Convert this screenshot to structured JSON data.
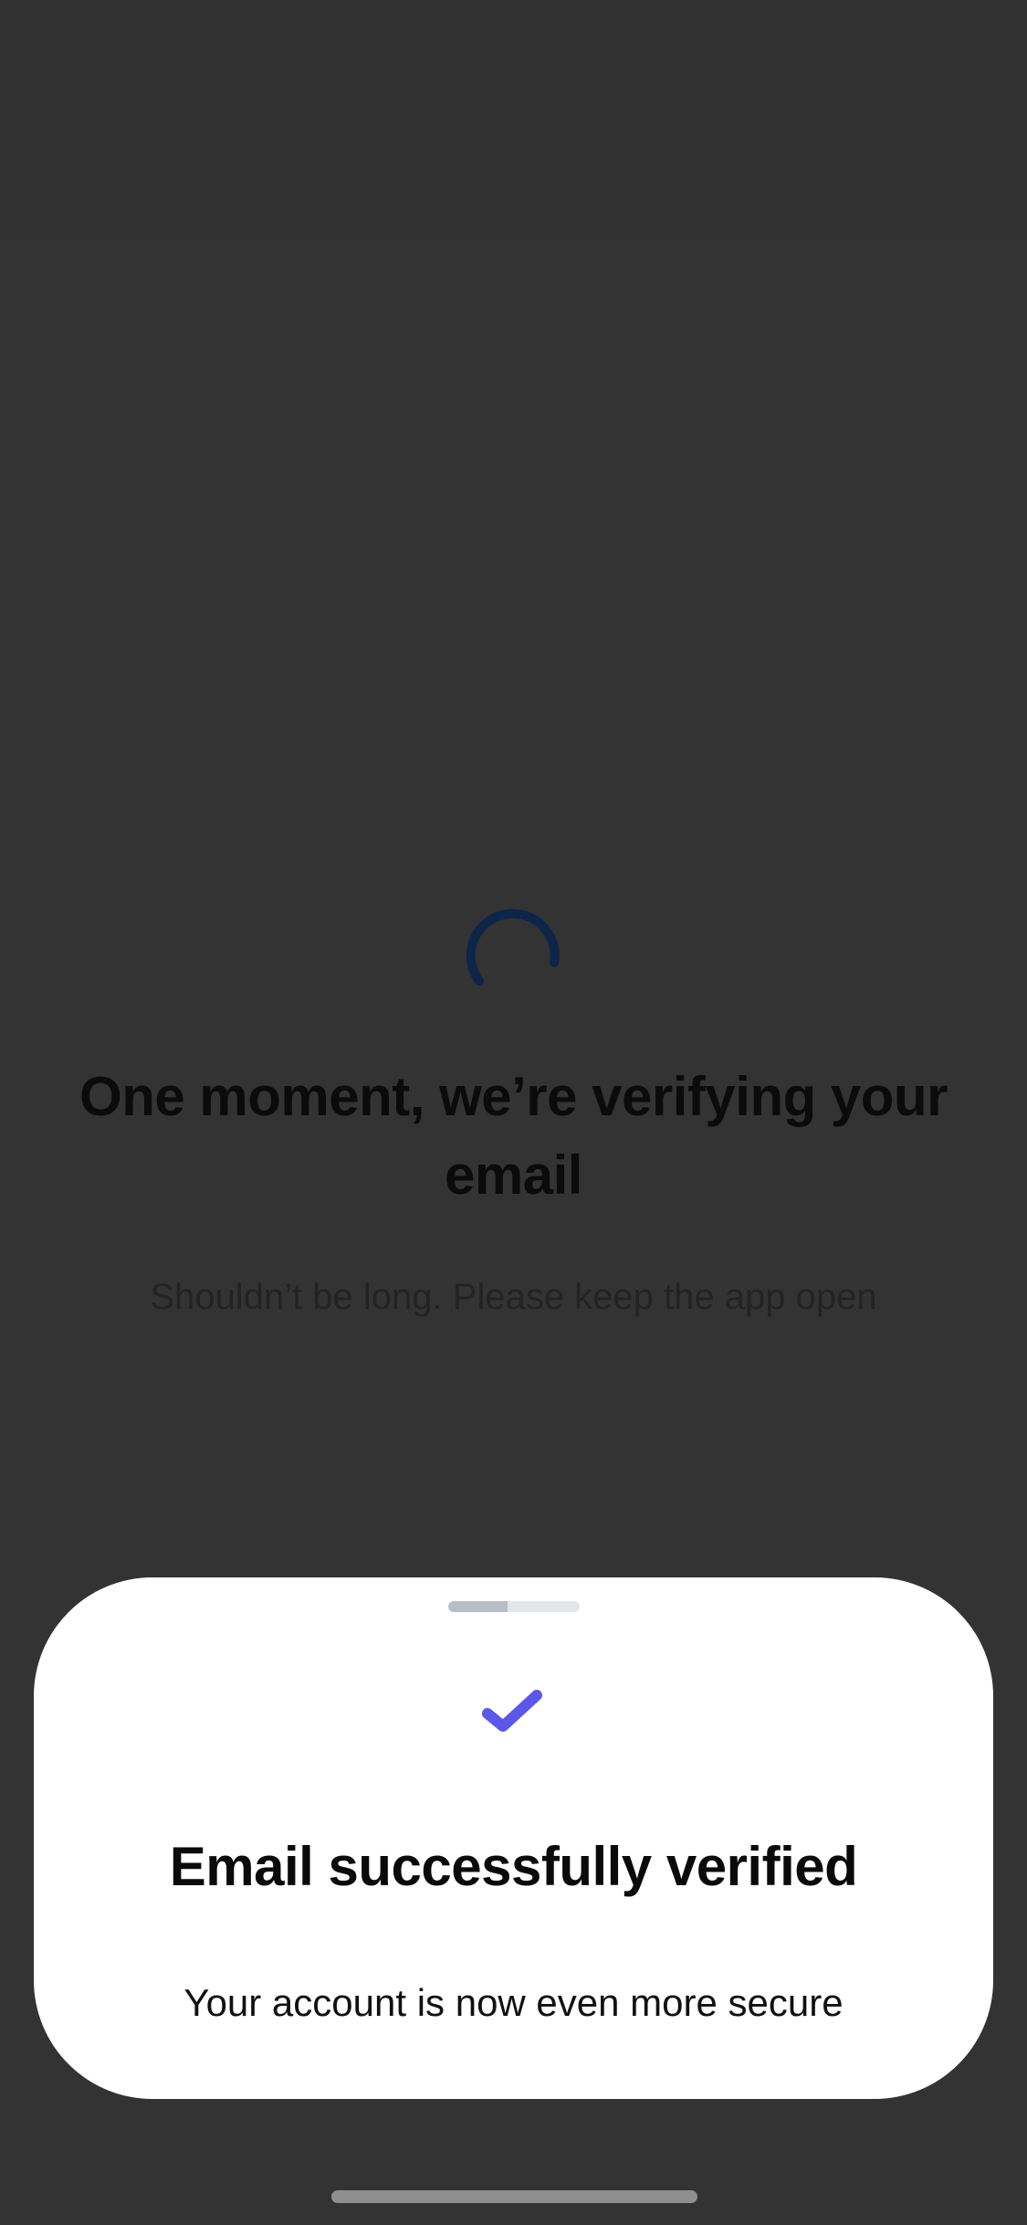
{
  "background": {
    "title": "One moment, we’re verifying your email",
    "subtitle": "Shouldn’t be long. Please keep the app open",
    "spinner_icon": "loading-spinner-icon"
  },
  "sheet": {
    "handle_progress": 0.45,
    "icon": "checkmark-icon",
    "title": "Email successfully verified",
    "subtitle": "Your account is now even more secure"
  },
  "colors": {
    "overlay": "#333333",
    "spinner": "#0d2549",
    "check": "#5b57e8",
    "sheet": "#ffffff"
  }
}
